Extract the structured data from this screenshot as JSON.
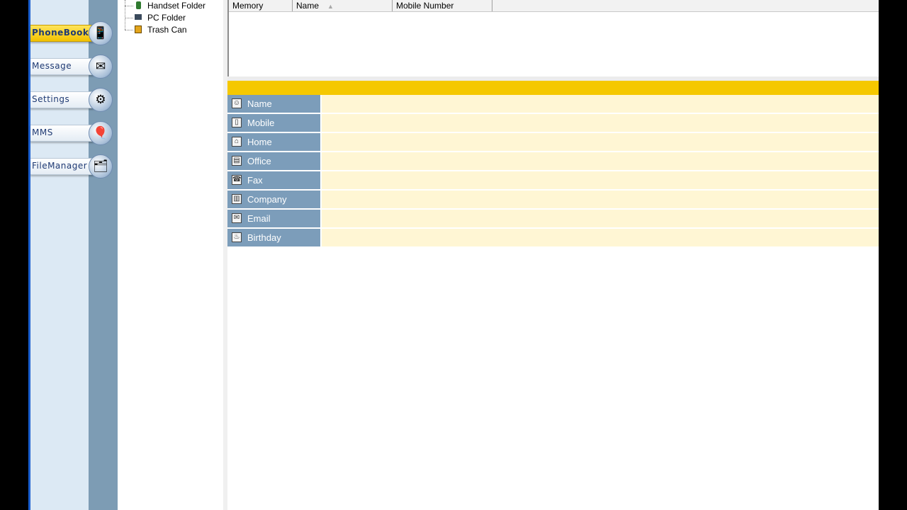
{
  "nav": {
    "items": [
      {
        "label": "PhoneBook",
        "icon": "phone-icon",
        "glyph": "📱"
      },
      {
        "label": "Message",
        "icon": "envelope-icon",
        "glyph": "✉"
      },
      {
        "label": "Settings",
        "icon": "settings-icon",
        "glyph": "⚙"
      },
      {
        "label": "MMS",
        "icon": "balloon-icon",
        "glyph": "🎈"
      },
      {
        "label": "FileManager",
        "icon": "folder-icon",
        "glyph": "🗂"
      }
    ]
  },
  "tree": {
    "items": [
      {
        "label": "Handset Folder",
        "icon": "handset-folder-icon"
      },
      {
        "label": "PC Folder",
        "icon": "pc-folder-icon"
      },
      {
        "label": "Trash Can",
        "icon": "trash-can-icon"
      }
    ]
  },
  "list": {
    "columns": [
      "Memory",
      "Name",
      "Mobile Number"
    ],
    "sort_indicator": "▲"
  },
  "detail": {
    "fields": [
      {
        "label": "Name",
        "icon": "person-icon",
        "glyph": "☺",
        "value": ""
      },
      {
        "label": "Mobile",
        "icon": "mobile-icon",
        "glyph": "▯",
        "value": ""
      },
      {
        "label": "Home",
        "icon": "home-icon",
        "glyph": "⌂",
        "value": ""
      },
      {
        "label": "Office",
        "icon": "office-icon",
        "glyph": "▤",
        "value": ""
      },
      {
        "label": "Fax",
        "icon": "fax-icon",
        "glyph": "☎",
        "value": ""
      },
      {
        "label": "Company",
        "icon": "company-icon",
        "glyph": "▥",
        "value": ""
      },
      {
        "label": "Email",
        "icon": "email-icon",
        "glyph": "✉",
        "value": ""
      },
      {
        "label": "Birthday",
        "icon": "birthday-icon",
        "glyph": "♨",
        "value": ""
      }
    ]
  },
  "colors": {
    "accent_yellow": "#f5c800",
    "label_blue": "#7c9dba",
    "value_cream": "#fff6d4"
  }
}
